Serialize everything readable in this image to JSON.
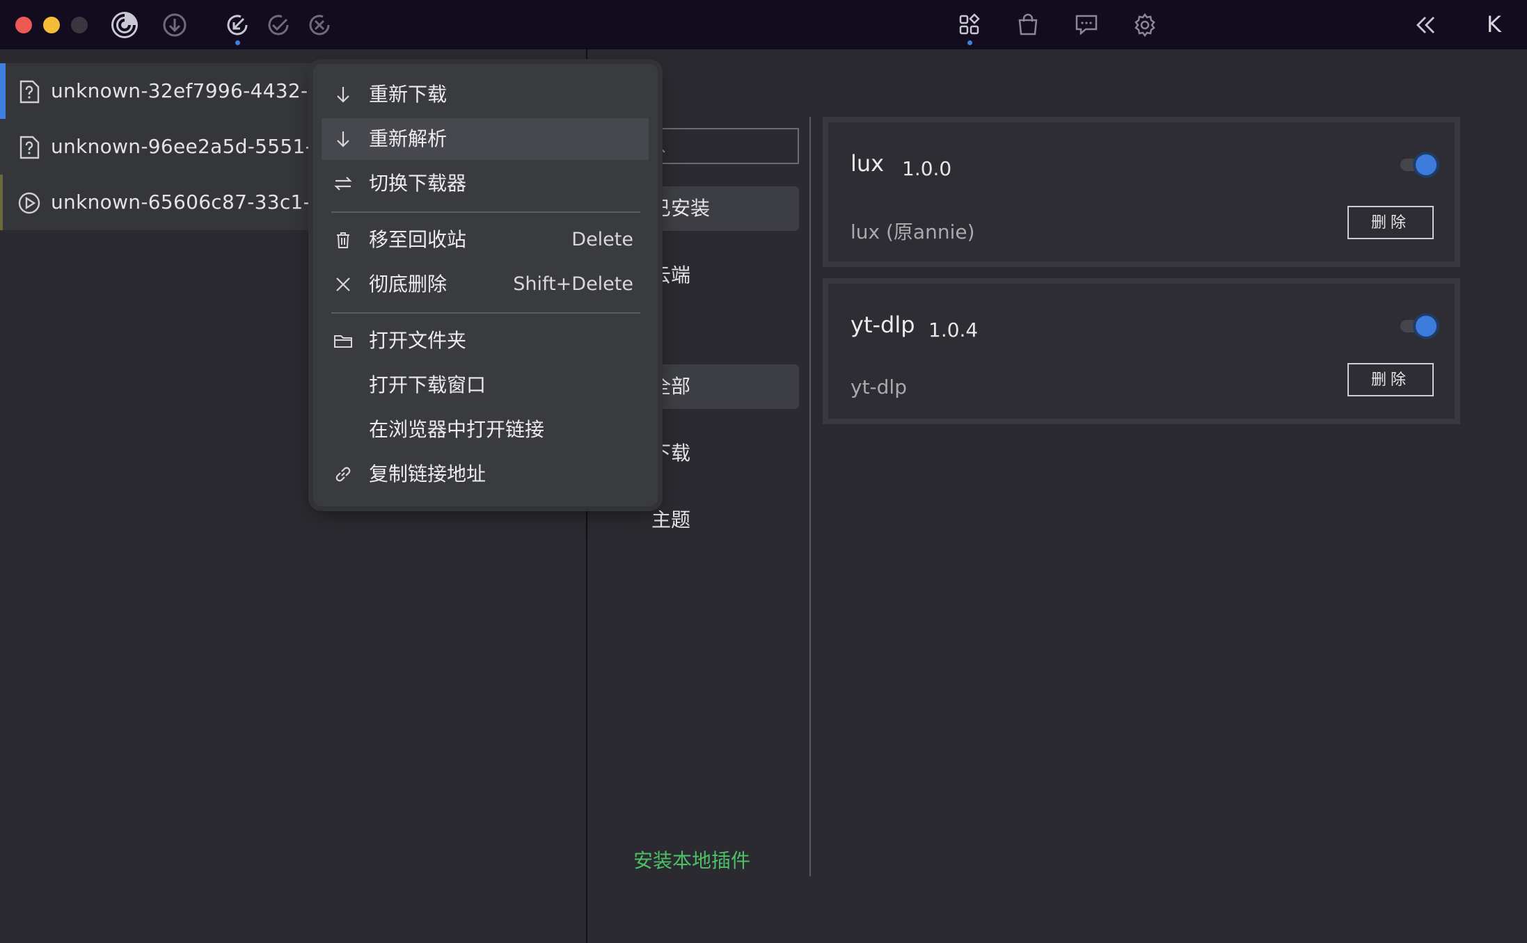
{
  "titlebar": {
    "left_icons": [
      "app-logo-icon",
      "download-arrow-icon",
      "downloading-icon",
      "completed-check-icon",
      "failed-x-icon"
    ],
    "right_icons": [
      "plugins-grid-icon",
      "store-bag-icon",
      "feedback-chat-icon",
      "settings-gear-icon"
    ],
    "collapse_icon": "double-chevron-left-icon",
    "brand_letter": "K"
  },
  "downloads": {
    "items": [
      {
        "name": "unknown-32ef7996-4432-4fa",
        "icon": "file-question-icon",
        "accent": "#3f7fe0"
      },
      {
        "name": "unknown-96ee2a5d-5551-44",
        "icon": "file-question-icon",
        "accent": "#35363a"
      },
      {
        "name": "unknown-65606c87-33c1-46",
        "icon": "play-circle-icon",
        "accent": "#6b6a3a"
      }
    ]
  },
  "plugins_nav": {
    "search_placeholder": "",
    "installed": "已安装",
    "cloud": "云端",
    "all": "全部",
    "download": "下载",
    "theme": "主题",
    "install_local": "安装本地插件"
  },
  "plugins": [
    {
      "name": "lux",
      "version": "1.0.0",
      "description": "lux (原annie)",
      "enabled": true,
      "delete_label": "删除"
    },
    {
      "name": "yt-dlp",
      "version": "1.0.4",
      "description": "yt-dlp",
      "enabled": true,
      "delete_label": "删除"
    }
  ],
  "context_menu": {
    "items": [
      {
        "label": "重新下载",
        "icon": "arrow-down-icon",
        "shortcut": ""
      },
      {
        "label": "重新解析",
        "icon": "arrow-down-icon",
        "shortcut": ""
      },
      {
        "label": "切换下载器",
        "icon": "swap-icon",
        "shortcut": ""
      },
      {
        "label": "移至回收站",
        "icon": "trash-icon",
        "shortcut": "Delete"
      },
      {
        "label": "彻底删除",
        "icon": "close-x-icon",
        "shortcut": "Shift+Delete"
      },
      {
        "label": "打开文件夹",
        "icon": "folder-icon",
        "shortcut": ""
      },
      {
        "label": "打开下载窗口",
        "icon": "",
        "shortcut": ""
      },
      {
        "label": "在浏览器中打开链接",
        "icon": "",
        "shortcut": ""
      },
      {
        "label": "复制链接地址",
        "icon": "link-icon",
        "shortcut": ""
      }
    ],
    "highlighted_index": 1
  },
  "colors": {
    "titlebar_bg": "#120c1e",
    "accent_blue": "#3f7fe0",
    "install_green": "#4cc065",
    "panel_bg": "#2b2a30"
  }
}
